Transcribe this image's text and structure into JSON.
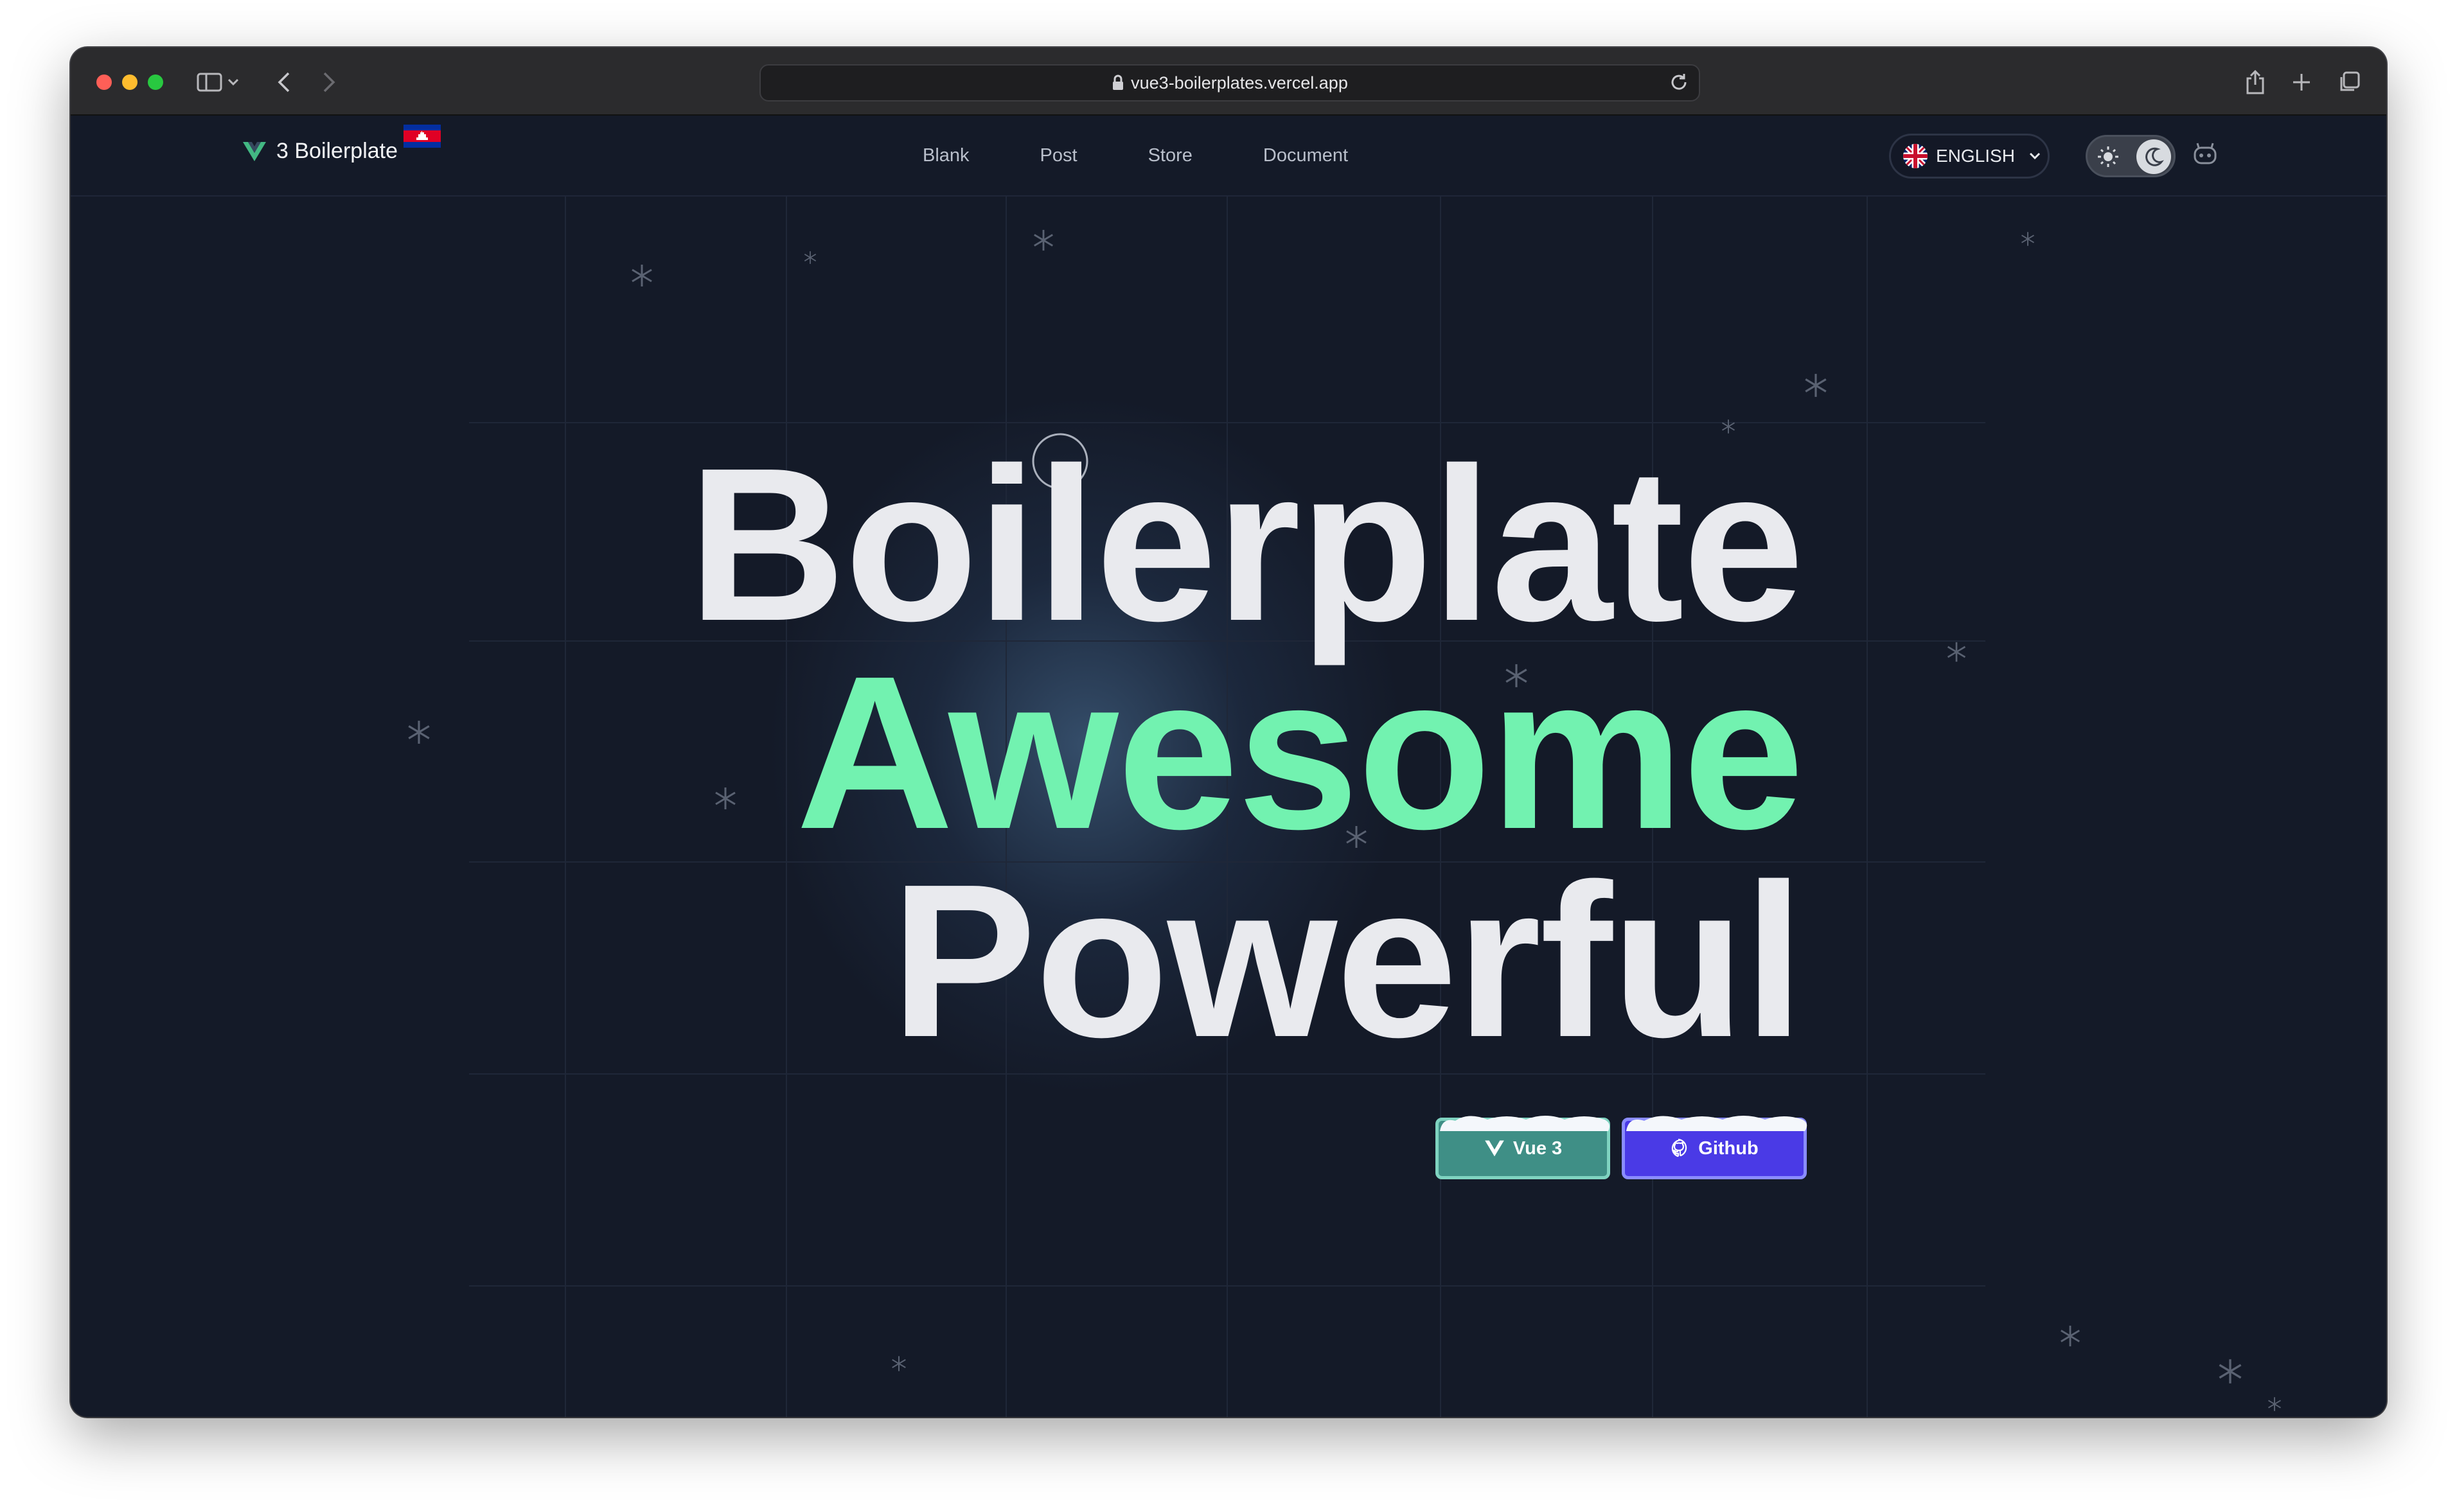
{
  "browser": {
    "url": "vue3-boilerplates.vercel.app"
  },
  "navbar": {
    "brand": "3 Boilerplate",
    "links": [
      "Blank",
      "Post",
      "Store",
      "Document"
    ],
    "language": "ENGLISH"
  },
  "hero": {
    "line1": "Boilerplate",
    "line2": "Awesome",
    "line3": "Powerful"
  },
  "buttons": {
    "vue": "Vue 3",
    "github": "Github"
  },
  "colors": {
    "background": "#141a28",
    "accent_green": "#72f2b0",
    "vue_button": "#3f8f86",
    "github_button": "#4a3ae6",
    "headline": "#e9eaee"
  }
}
